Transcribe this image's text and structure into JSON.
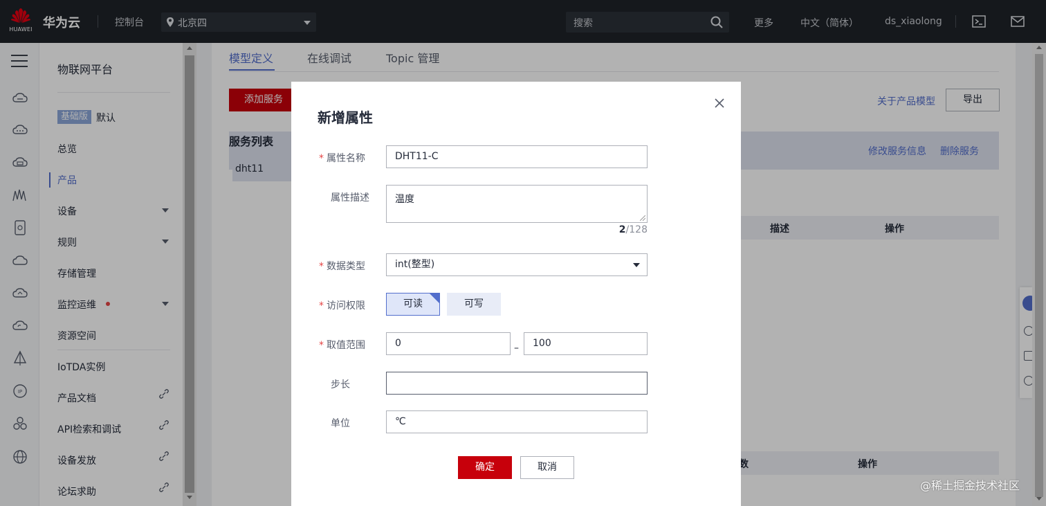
{
  "topbar": {
    "logo_text": "HUAWEI",
    "brand": "华为云",
    "console": "控制台",
    "region": "北京四",
    "search_placeholder": "搜索",
    "more": "更多",
    "language": "中文（简体）",
    "username": "ds_xiaolong"
  },
  "sidebar": {
    "title": "物联网平台",
    "badge": "基础版",
    "badge_suffix": "默认",
    "items": [
      {
        "label": "总览"
      },
      {
        "label": "产品"
      },
      {
        "label": "设备"
      },
      {
        "label": "规则"
      },
      {
        "label": "存储管理"
      },
      {
        "label": "监控运维"
      },
      {
        "label": "资源空间"
      },
      {
        "label": "IoTDA实例"
      },
      {
        "label": "产品文档"
      },
      {
        "label": "API检索和调试"
      },
      {
        "label": "设备发放"
      },
      {
        "label": "论坛求助"
      }
    ]
  },
  "main": {
    "tabs": [
      "模型定义",
      "在线调试",
      "Topic 管理"
    ],
    "add_service": "添加服务",
    "about_model": "关于产品模型",
    "export": "导出",
    "service_list_title": "服务列表",
    "service_item": "dht11",
    "edit_service": "修改服务信息",
    "delete_service": "删除服务",
    "table1_headers": [
      "描述",
      "操作"
    ],
    "table2_headers": [
      "数",
      "操作"
    ]
  },
  "modal": {
    "title": "新增属性",
    "fields": {
      "name_label": "属性名称",
      "name_value": "DHT11-C",
      "desc_label": "属性描述",
      "desc_value": "温度",
      "desc_count": "2",
      "desc_max": "/128",
      "type_label": "数据类型",
      "type_value": "int(整型)",
      "access_label": "访问权限",
      "access_read": "可读",
      "access_write": "可写",
      "range_label": "取值范围",
      "range_min": "0",
      "range_sep": "–",
      "range_max": "100",
      "step_label": "步长",
      "step_value": "",
      "unit_label": "单位",
      "unit_value": "℃"
    },
    "ok": "确定",
    "cancel": "取消"
  },
  "watermark": "@稀土掘金技术社区",
  "colors": {
    "topbar_bg": "#1f2329",
    "primary_red": "#c7000b",
    "accent_blue": "#526ecc",
    "required_star": "#e54545"
  }
}
